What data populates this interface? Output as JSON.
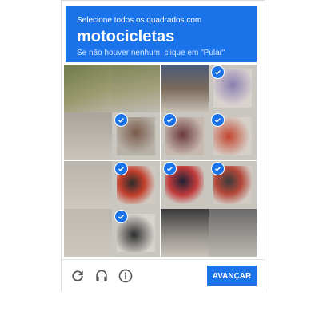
{
  "header": {
    "instruction": "Selecione todos os quadrados com",
    "target": "motocicletas",
    "hint": "Se não houver nenhum, clique em \"Pular\""
  },
  "grid": {
    "rows": 4,
    "cols": 4,
    "tiles": [
      {
        "row": 0,
        "col": 0,
        "selected": false
      },
      {
        "row": 0,
        "col": 1,
        "selected": false
      },
      {
        "row": 0,
        "col": 2,
        "selected": false
      },
      {
        "row": 0,
        "col": 3,
        "selected": true
      },
      {
        "row": 1,
        "col": 0,
        "selected": false
      },
      {
        "row": 1,
        "col": 1,
        "selected": true
      },
      {
        "row": 1,
        "col": 2,
        "selected": true
      },
      {
        "row": 1,
        "col": 3,
        "selected": true
      },
      {
        "row": 2,
        "col": 0,
        "selected": false
      },
      {
        "row": 2,
        "col": 1,
        "selected": true
      },
      {
        "row": 2,
        "col": 2,
        "selected": true
      },
      {
        "row": 2,
        "col": 3,
        "selected": true
      },
      {
        "row": 3,
        "col": 0,
        "selected": false
      },
      {
        "row": 3,
        "col": 1,
        "selected": true
      },
      {
        "row": 3,
        "col": 2,
        "selected": false
      },
      {
        "row": 3,
        "col": 3,
        "selected": false
      }
    ]
  },
  "footer": {
    "icons": [
      "reload-icon",
      "headphones-icon",
      "info-icon"
    ],
    "verify_label": "AVANÇAR"
  },
  "colors": {
    "accent": "#1a73e8"
  }
}
